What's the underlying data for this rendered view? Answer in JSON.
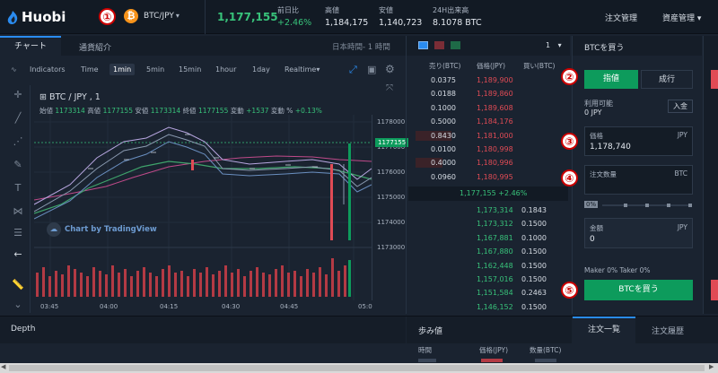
{
  "header": {
    "logo": "Huobi",
    "badge1": "①",
    "coin_symbol": "₿",
    "pair": "BTC/JPY",
    "last_price": "1,177,155",
    "stats": [
      {
        "label": "前日比",
        "value": "+2.46%"
      },
      {
        "label": "高値",
        "value": "1,184,175"
      },
      {
        "label": "安値",
        "value": "1,140,723"
      },
      {
        "label": "24H出来高",
        "value": "8.1078 BTC"
      }
    ],
    "nav": [
      "注文管理",
      "資産管理"
    ]
  },
  "chart": {
    "tabs": [
      "チャート",
      "通貨紹介"
    ],
    "timezone": "日本時間- 1 時間",
    "toolbar": [
      "Indicators",
      "Time",
      "1min",
      "5min",
      "15min",
      "1hour",
      "1day",
      "Realtime"
    ],
    "active_interval": "1min",
    "title": "BTC / JPY , 1",
    "ohlc": {
      "open_label": "始値",
      "open": "1173314",
      "high_label": "高値",
      "high": "1177155",
      "low_label": "安値",
      "low": "1173314",
      "close_label": "終値",
      "close": "1177155",
      "change_label": "変動",
      "change": "+1537",
      "pct_label": "変動 %",
      "pct": "+0.13%"
    },
    "y_ticks": [
      "1178000",
      "1177000",
      "1176000",
      "1175000",
      "1174000",
      "1173000"
    ],
    "current_label": "1177155",
    "x_ticks": [
      "03:45",
      "04:00",
      "04:15",
      "04:30",
      "04:45",
      "05:0"
    ],
    "watermark": "Chart by TradingView"
  },
  "orderbook": {
    "depth_option": "1",
    "headers": [
      "売り(BTC)",
      "価格(JPY)",
      "買い(BTC)"
    ],
    "asks": [
      {
        "size": "0.0375",
        "price": "1,189,900"
      },
      {
        "size": "0.0188",
        "price": "1,189,860"
      },
      {
        "size": "0.1000",
        "price": "1,189,608"
      },
      {
        "size": "0.5000",
        "price": "1,184,176"
      },
      {
        "size": "0.8430",
        "price": "1,181,000"
      },
      {
        "size": "0.0100",
        "price": "1,180,998"
      },
      {
        "size": "0.4000",
        "price": "1,180,996"
      },
      {
        "size": "0.0960",
        "price": "1,180,995"
      }
    ],
    "mid": "1,177,155 +2.46%",
    "bids": [
      {
        "price": "1,173,314",
        "size": "0.1843"
      },
      {
        "price": "1,173,312",
        "size": "0.1500"
      },
      {
        "price": "1,167,881",
        "size": "0.1000"
      },
      {
        "price": "1,167,880",
        "size": "0.1500"
      },
      {
        "price": "1,162,448",
        "size": "0.1500"
      },
      {
        "price": "1,157,016",
        "size": "0.1500"
      },
      {
        "price": "1,151,584",
        "size": "0.2463"
      },
      {
        "price": "1,146,152",
        "size": "0.1500"
      }
    ]
  },
  "buy_form": {
    "title": "BTCを買う",
    "badge2": "②",
    "badge3": "③",
    "badge4": "④",
    "badge5": "⑤",
    "limit_tab": "指値",
    "market_tab": "成行",
    "available_label": "利用可能",
    "available": "0 JPY",
    "deposit": "入金",
    "price_label": "価格",
    "price_unit": "JPY",
    "price_value": "1,178,740",
    "qty_label": "注文数量",
    "qty_unit": "BTC",
    "slider_pct": "0%",
    "amount_label": "金額",
    "amount_unit": "JPY",
    "amount_value": "0",
    "fees": "Maker 0% Taker 0%",
    "buy_button": "BTCを買う"
  },
  "bottom": {
    "depth": "Depth",
    "trades_title": "歩み値",
    "trades_headers": [
      "時間",
      "価格(JPY)",
      "数量(BTC)"
    ],
    "order_tabs": [
      "注文一覧",
      "注文履歴"
    ]
  },
  "colors": {
    "up": "#38c27a",
    "down": "#e04b55",
    "accent": "#0d9b5c",
    "bg": "#1a2330"
  },
  "chart_data": {
    "type": "candlestick",
    "y_range": [
      1173000,
      1178000
    ],
    "last": 1177155
  }
}
